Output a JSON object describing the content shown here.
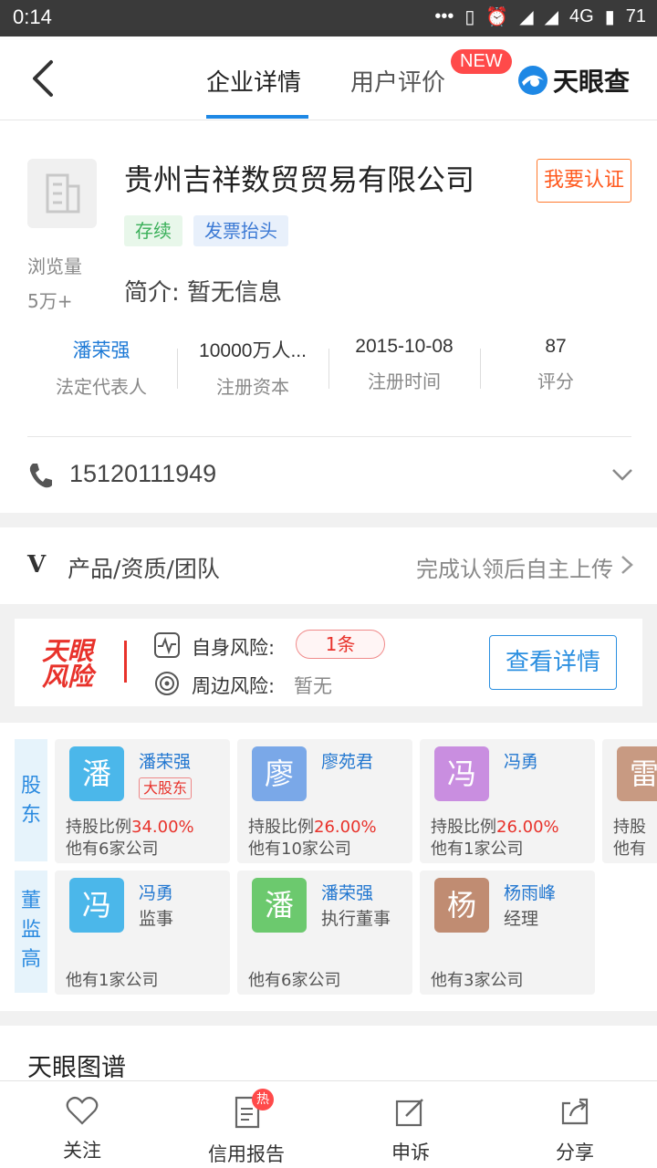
{
  "status": {
    "time": "0:14",
    "network": "4G",
    "battery": "71"
  },
  "nav": {
    "tab_detail": "企业详情",
    "tab_review": "用户评价",
    "new_badge": "NEW",
    "logo_text": "天眼查"
  },
  "company": {
    "name": "贵州吉祥数贸贸易有限公司",
    "claim_button": "我要认证",
    "tag_status": "存续",
    "tag_invoice": "发票抬头",
    "views_label": "浏览量",
    "views_value": "5万+",
    "intro": "简介: 暂无信息",
    "stats": [
      {
        "value": "潘荣强",
        "label": "法定代表人"
      },
      {
        "value": "10000万人...",
        "label": "注册资本"
      },
      {
        "value": "2015-10-08",
        "label": "注册时间"
      },
      {
        "value": "87",
        "label": "评分"
      }
    ],
    "phone": "15120111949"
  },
  "products": {
    "icon_letter": "V",
    "label": "产品/资质/团队",
    "action": "完成认领后自主上传"
  },
  "risk": {
    "brand_line1": "天眼",
    "brand_line2": "风险",
    "self_label": "自身风险:",
    "self_count": "1条",
    "around_label": "周边风险:",
    "around_value": "暂无",
    "detail_button": "查看详情"
  },
  "shareholders": {
    "side_label_1": "股",
    "side_label_2": "东",
    "items": [
      {
        "avatar": "潘",
        "name": "潘荣强",
        "tag": "大股东",
        "share_label": "持股比例",
        "share": "34.00%",
        "other": "他有6家公司",
        "color": "#4bb7ea"
      },
      {
        "avatar": "廖",
        "name": "廖苑君",
        "tag": "",
        "share_label": "持股比例",
        "share": "26.00%",
        "other": "他有10家公司",
        "color": "#7aa8e8"
      },
      {
        "avatar": "冯",
        "name": "冯勇",
        "tag": "",
        "share_label": "持股比例",
        "share": "26.00%",
        "other": "他有1家公司",
        "color": "#c98ee0"
      },
      {
        "avatar": "雷",
        "name": "",
        "tag": "",
        "share_label": "持股",
        "share": "",
        "other": "他有",
        "color": "#c89a82"
      }
    ]
  },
  "executives": {
    "side_label_1": "董",
    "side_label_2": "监",
    "side_label_3": "高",
    "items": [
      {
        "avatar": "冯",
        "name": "冯勇",
        "role": "监事",
        "other": "他有1家公司",
        "color": "#4bb7ea"
      },
      {
        "avatar": "潘",
        "name": "潘荣强",
        "role": "执行董事",
        "other": "他有6家公司",
        "color": "#6cc96e"
      },
      {
        "avatar": "杨",
        "name": "杨雨峰",
        "role": "经理",
        "other": "他有3家公司",
        "color": "#c08c72"
      }
    ]
  },
  "graph_title": "天眼图谱",
  "bottom_nav": [
    {
      "label": "关注",
      "icon": "heart-icon"
    },
    {
      "label": "信用报告",
      "icon": "report-icon",
      "badge": "热"
    },
    {
      "label": "申诉",
      "icon": "edit-icon"
    },
    {
      "label": "分享",
      "icon": "share-icon"
    }
  ],
  "colors": {
    "accent": "#1e88e5",
    "danger": "#e8322b",
    "claim": "#ff5a1f"
  }
}
